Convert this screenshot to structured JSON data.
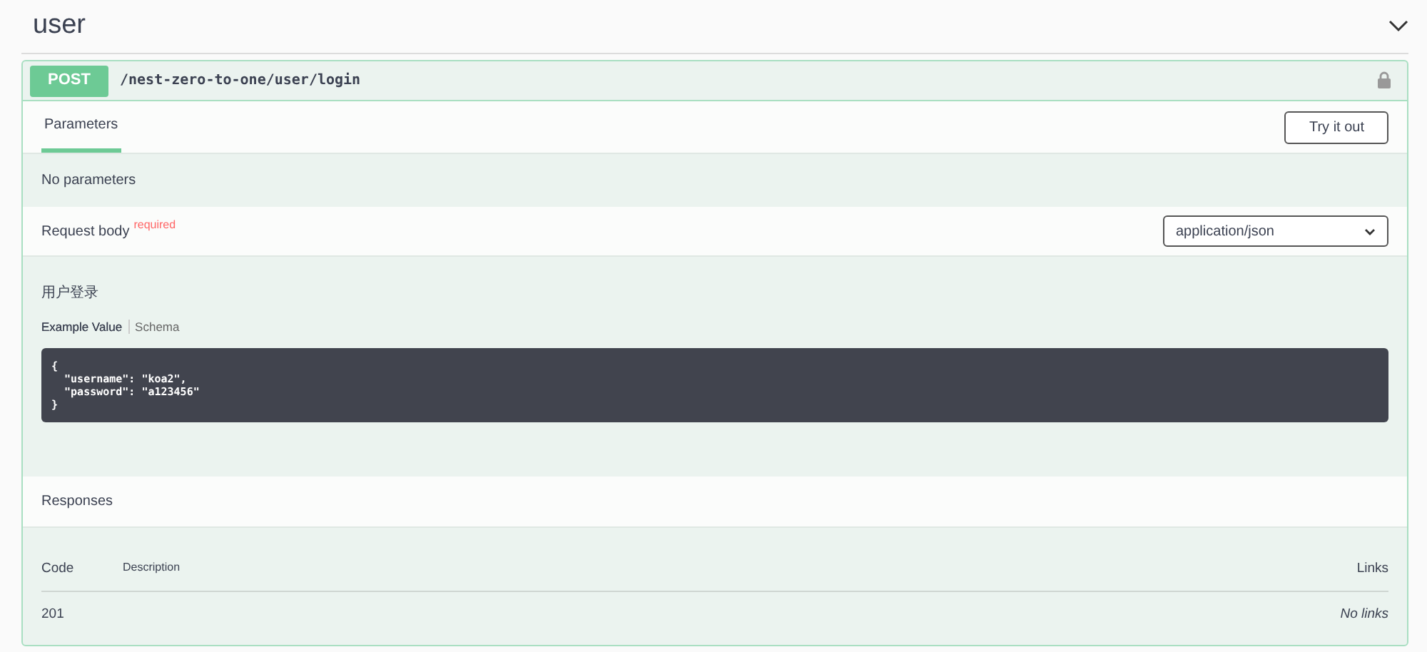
{
  "tag": {
    "name": "user",
    "expanded": true
  },
  "operation": {
    "method": "POST",
    "path": "/nest-zero-to-one/user/login",
    "locked": true
  },
  "tabs": [
    {
      "label": "Parameters",
      "selected": true
    }
  ],
  "try_button": "Try it out",
  "parameters_text": "No parameters",
  "request_body": {
    "label": "Request body",
    "required_mark": "required",
    "content_type": "application/json",
    "description": "用户登录",
    "views": [
      {
        "label": "Example Value",
        "selected": true
      },
      {
        "label": "Schema",
        "selected": false
      }
    ],
    "example": [
      "{",
      "  \"username\": \"koa2\",",
      "  \"password\": \"a123456\"",
      "}"
    ]
  },
  "responses": {
    "title": "Responses",
    "columns": [
      "Code",
      "Description",
      "Links"
    ],
    "rows": [
      {
        "code": "201",
        "description": "",
        "links": "No links"
      }
    ]
  }
}
